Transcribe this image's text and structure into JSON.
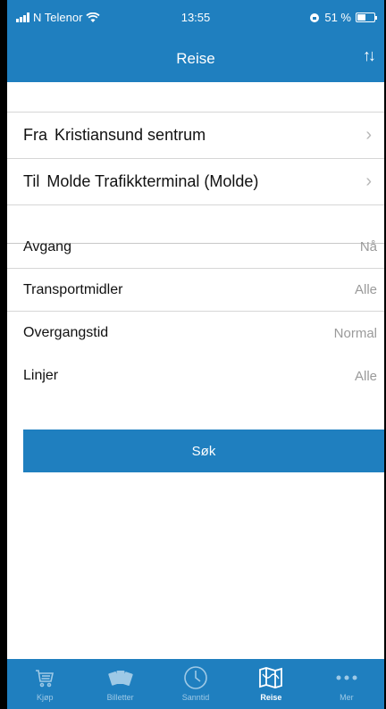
{
  "status": {
    "carrier": "N Telenor",
    "time": "13:55",
    "battery": "51 %",
    "battery_level": 0.51
  },
  "nav": {
    "title": "Reise",
    "swap_icon": "swap-arrows-icon"
  },
  "from": {
    "prefix": "Fra",
    "value": "Kristiansund sentrum"
  },
  "to": {
    "prefix": "Til",
    "value": "Molde Trafikkterminal (Molde)"
  },
  "options": [
    {
      "label": "Avgang",
      "value": "Nå"
    },
    {
      "label": "Transportmidler",
      "value": "Alle"
    },
    {
      "label": "Overgangstid",
      "value": "Normal"
    },
    {
      "label": "Linjer",
      "value": "Alle"
    }
  ],
  "search_label": "Søk",
  "tabs": [
    {
      "label": "Kjøp",
      "icon": "cart-icon"
    },
    {
      "label": "Billetter",
      "icon": "tickets-icon"
    },
    {
      "label": "Sanntid",
      "icon": "clock-icon"
    },
    {
      "label": "Reise",
      "icon": "map-icon"
    },
    {
      "label": "Mer",
      "icon": "more-icon"
    }
  ],
  "active_tab": "Reise",
  "colors": {
    "brand": "#1f7fbf",
    "tab_inactive": "#9ec9e6"
  }
}
